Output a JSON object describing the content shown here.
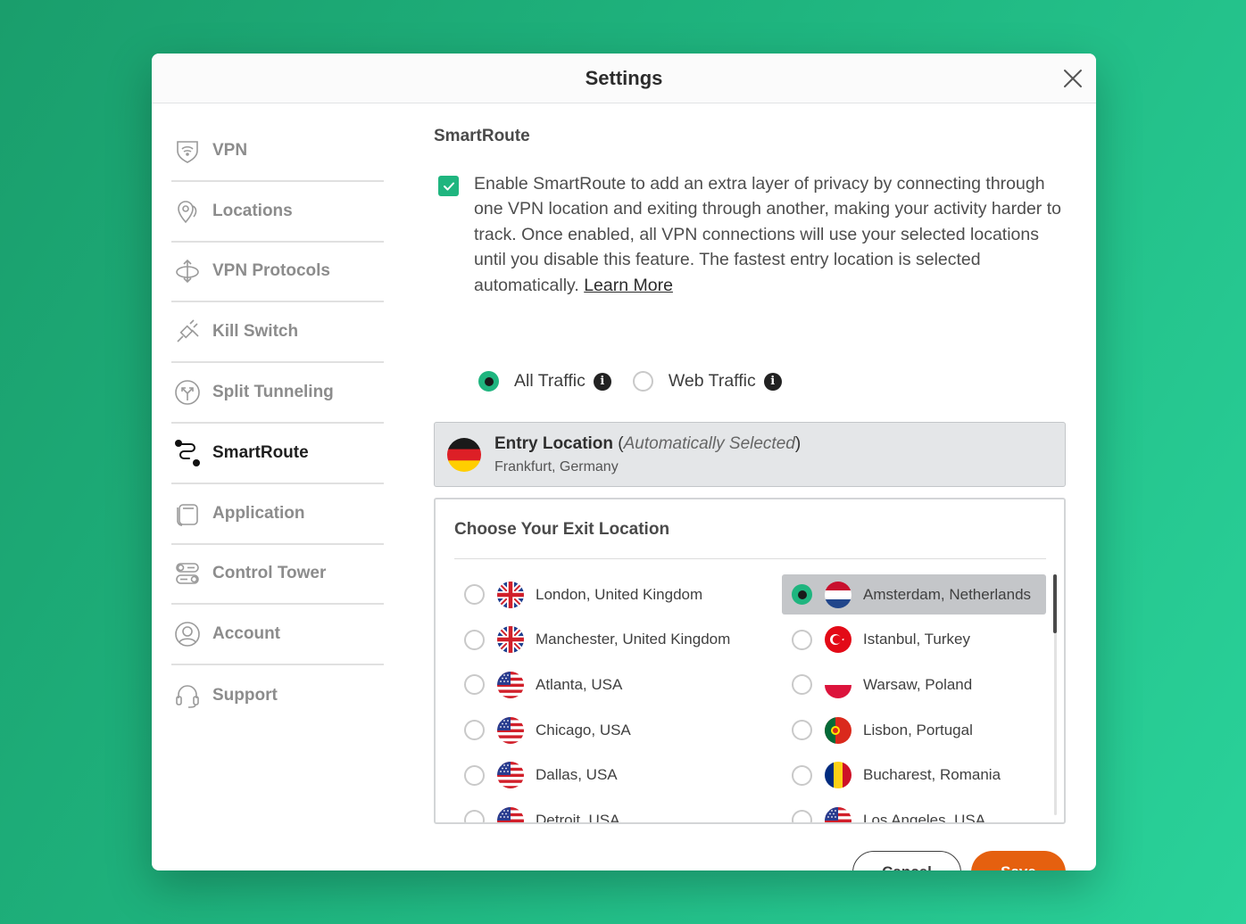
{
  "dialog": {
    "title": "Settings"
  },
  "sidebar": {
    "items": [
      {
        "label": "VPN",
        "icon": "shield-wifi-icon"
      },
      {
        "label": "Locations",
        "icon": "location-pin-icon"
      },
      {
        "label": "VPN Protocols",
        "icon": "protocols-icon"
      },
      {
        "label": "Kill Switch",
        "icon": "plug-disconnect-icon"
      },
      {
        "label": "Split Tunneling",
        "icon": "split-arrows-icon"
      },
      {
        "label": "SmartRoute",
        "icon": "route-icon",
        "active": true
      },
      {
        "label": "Application",
        "icon": "application-icon"
      },
      {
        "label": "Control Tower",
        "icon": "toggles-icon"
      },
      {
        "label": "Account",
        "icon": "user-circle-icon"
      },
      {
        "label": "Support",
        "icon": "headset-icon"
      }
    ]
  },
  "smartroute": {
    "title": "SmartRoute",
    "enabled": true,
    "description": "Enable SmartRoute to add an extra layer of privacy by connecting through one VPN location and exiting through another, making your activity harder to track. Once enabled, all VPN connections will use your selected locations until you disable this feature. The fastest entry location is selected automatically.",
    "learn_more": "Learn More",
    "traffic": {
      "all_label": "All Traffic",
      "web_label": "Web Traffic",
      "selected": "all"
    },
    "entry": {
      "title": "Entry Location",
      "qualifier": "Automatically Selected",
      "location": "Frankfurt, Germany",
      "flag": "germany"
    },
    "exit": {
      "title": "Choose Your Exit Location",
      "left": [
        {
          "label": "London, United Kingdom",
          "flag": "uk"
        },
        {
          "label": "Manchester, United Kingdom",
          "flag": "uk"
        },
        {
          "label": "Atlanta, USA",
          "flag": "usa"
        },
        {
          "label": "Chicago, USA",
          "flag": "usa"
        },
        {
          "label": "Dallas, USA",
          "flag": "usa"
        },
        {
          "label": "Detroit, USA",
          "flag": "usa"
        }
      ],
      "right": [
        {
          "label": "Amsterdam, Netherlands",
          "flag": "netherlands",
          "selected": true
        },
        {
          "label": "Istanbul, Turkey",
          "flag": "turkey"
        },
        {
          "label": "Warsaw, Poland",
          "flag": "poland"
        },
        {
          "label": "Lisbon, Portugal",
          "flag": "portugal"
        },
        {
          "label": "Bucharest, Romania",
          "flag": "romania"
        },
        {
          "label": "Los Angeles, USA",
          "flag": "usa"
        }
      ]
    }
  },
  "buttons": {
    "cancel": "Cancel",
    "save": "Save"
  },
  "colors": {
    "accent": "#1fb57f",
    "save": "#e5600f",
    "background": "#1fb57f"
  }
}
